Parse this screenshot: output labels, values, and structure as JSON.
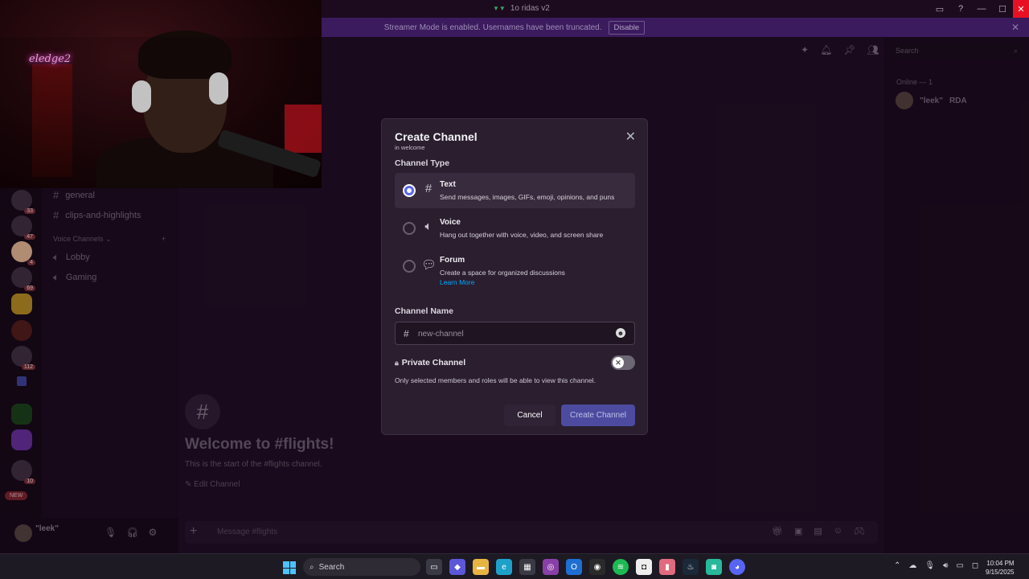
{
  "window": {
    "title": "1o ridas v2"
  },
  "banner": {
    "text": "Streamer Mode is enabled. Usernames have been truncated.",
    "disable_label": "Disable"
  },
  "servers": [
    {
      "badge": "33"
    },
    {
      "badge": "47"
    },
    {
      "badge": "4"
    },
    {
      "badge": "69"
    },
    {
      "badge": ""
    },
    {
      "badge": ""
    },
    {
      "badge": "112"
    },
    {
      "badge": ""
    },
    {
      "badge": ""
    },
    {
      "badge": "10"
    }
  ],
  "new_badge": "NEW",
  "sidebar": {
    "channels": [
      {
        "name": "general"
      },
      {
        "name": "clips-and-highlights"
      }
    ],
    "voice_category": "Voice Channels",
    "voice_channels": [
      {
        "name": "Lobby"
      },
      {
        "name": "Gaming"
      }
    ]
  },
  "user_panel": {
    "username": "\"leek\""
  },
  "header": {
    "search_placeholder": "Search"
  },
  "welcome": {
    "title": "Welcome to #flights!",
    "subtitle": "This is the start of the #flights channel.",
    "edit_label": "Edit Channel"
  },
  "composer": {
    "placeholder": "Message #flights"
  },
  "members": {
    "header": "Online — 1",
    "list": [
      {
        "name": "\"leek\"",
        "tag": "RDA"
      }
    ]
  },
  "webcam": {
    "neon_text": "eledge2"
  },
  "modal": {
    "title": "Create Channel",
    "subtitle": "in welcome",
    "type_heading": "Channel Type",
    "options": [
      {
        "label": "Text",
        "desc": "Send messages, images, GIFs, emoji, opinions, and puns",
        "icon": "hash-icon",
        "selected": true
      },
      {
        "label": "Voice",
        "desc": "Hang out together with voice, video, and screen share",
        "icon": "speaker-icon",
        "selected": false
      },
      {
        "label": "Forum",
        "desc": "Create a space for organized discussions",
        "link": "Learn More",
        "icon": "forum-icon",
        "selected": false
      }
    ],
    "name_heading": "Channel Name",
    "name_placeholder": "new-channel",
    "private_label": "Private Channel",
    "private_enabled": false,
    "private_desc": "Only selected members and roles will be able to view this channel.",
    "cancel_label": "Cancel",
    "create_label": "Create Channel"
  },
  "taskbar": {
    "search_label": "Search",
    "time": "10:04 PM",
    "date": "9/15/2025"
  },
  "colors": {
    "accent": "#5865f2",
    "banner": "#3b1a5e",
    "link": "#00a8fc"
  }
}
